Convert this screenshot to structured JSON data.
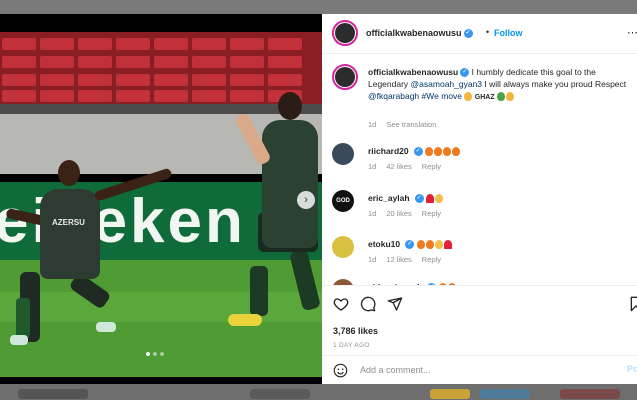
{
  "post": {
    "username": "officialkwabenaowusu",
    "follow_label": "Follow",
    "separator": "•",
    "sponsor_text": "AZERSU",
    "banner_text": "eineken",
    "carousel": {
      "total": 3,
      "active": 0
    }
  },
  "caption": {
    "username": "officialkwabenaowusu",
    "text_1": "I humbly dedicate this goal to the Legendary",
    "mention_1": "@asamoah_gyan3",
    "text_2": "I will always make you proud Respect",
    "mention_2": "@fkqarabagh",
    "text_3": "#We move",
    "trailing": "GHAZ",
    "time": "1d",
    "see_translation": "See translation"
  },
  "comments": [
    {
      "username": "riichard20",
      "emojis": [
        "fire",
        "fire",
        "fire",
        "fire"
      ],
      "time": "1d",
      "likes": "42 likes",
      "reply": "Reply",
      "avatar_color": "#3a4a5a"
    },
    {
      "username": "eric_aylah",
      "emojis": [
        "heart",
        "clap"
      ],
      "time": "1d",
      "likes": "20 likes",
      "reply": "Reply",
      "avatar_color": "#111111",
      "avatar_text": "GOD"
    },
    {
      "username": "etoku10",
      "emojis": [
        "fire",
        "fire",
        "clap",
        "heart"
      ],
      "time": "1d",
      "likes": "12 likes",
      "reply": "Reply",
      "avatar_color": "#d8c040"
    },
    {
      "username": "aidan_joseph",
      "emojis": [
        "fire",
        "fire"
      ],
      "time": "1d",
      "likes": "",
      "reply": "",
      "avatar_color": "#8a5a3a"
    }
  ],
  "actions": {
    "likes": "3,786 likes",
    "date": "1 DAY AGO"
  },
  "add_comment": {
    "placeholder": "Add a comment...",
    "post_label": "Po"
  },
  "colors": {
    "link": "#0095f6",
    "mention": "#00376b",
    "verified": "#3897f0",
    "muted": "#8e8e8e"
  }
}
